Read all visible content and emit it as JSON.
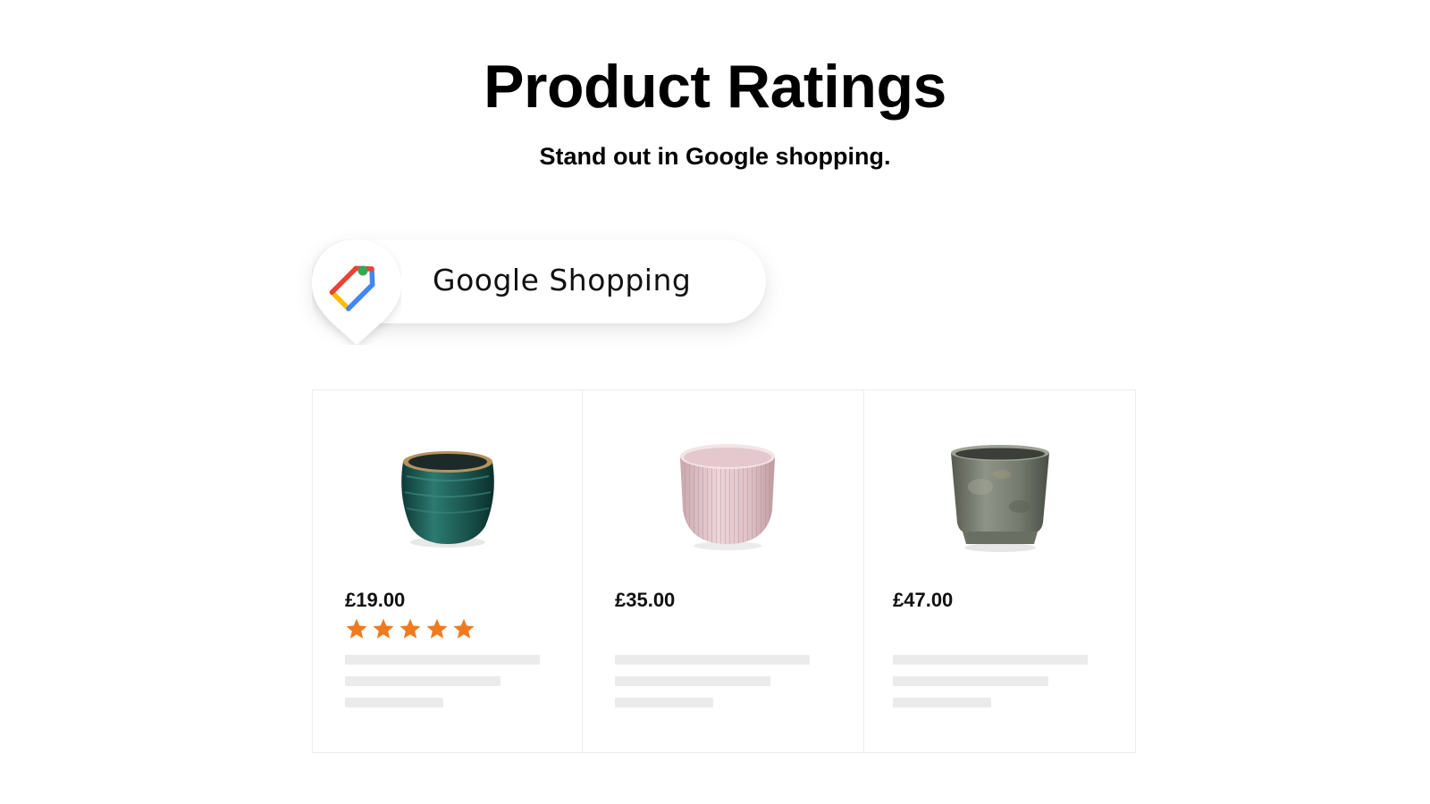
{
  "header": {
    "title": "Product Ratings",
    "subtitle": "Stand out in Google shopping."
  },
  "badge": {
    "label": "Google Shopping",
    "icon": "google-shopping-tag-icon",
    "colors": {
      "red": "#EA4335",
      "yellow": "#FBBC04",
      "blue": "#4285F4",
      "green": "#34A853"
    }
  },
  "products": [
    {
      "name": "teal-glazed-pot",
      "price": "£19.00",
      "rating": 5,
      "rating_max": 5,
      "image_icon": "teal-ceramic-pot-icon"
    },
    {
      "name": "pink-ribbed-pot",
      "price": "£35.00",
      "image_icon": "pink-ribbed-pot-icon"
    },
    {
      "name": "stone-grey-pot",
      "price": "£47.00",
      "image_icon": "grey-stone-pot-icon"
    }
  ],
  "colors": {
    "star": "#F07A1E",
    "skeleton": "#EBEBEB",
    "border": "#ECECEC"
  }
}
